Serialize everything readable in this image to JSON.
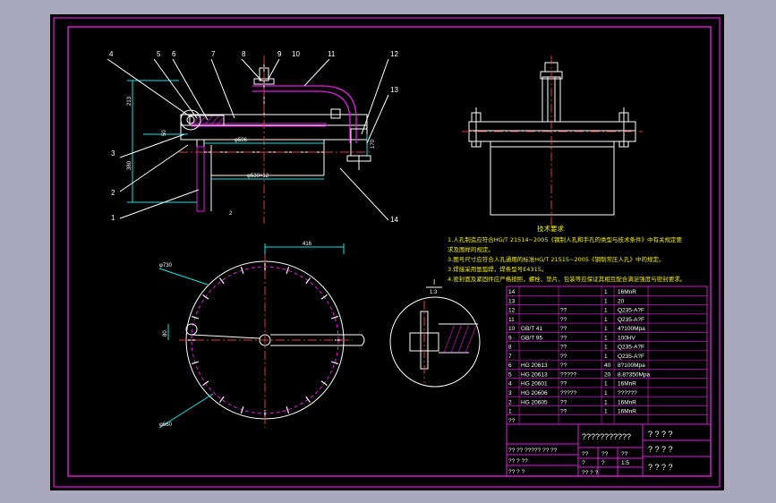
{
  "colors": {
    "background": "#a9a8bd",
    "sheet": "#000000",
    "frame": "#e01cdf",
    "outline": "#ffffff",
    "note_text": "#f4f000",
    "center_line": "#d24141",
    "dimension": "#18e2e2"
  },
  "callouts": [
    {
      "n": "4"
    },
    {
      "n": "5"
    },
    {
      "n": "6"
    },
    {
      "n": "7"
    },
    {
      "n": "8"
    },
    {
      "n": "9"
    },
    {
      "n": "10"
    },
    {
      "n": "11"
    },
    {
      "n": "12"
    },
    {
      "n": "13"
    },
    {
      "n": "3"
    },
    {
      "n": "2"
    },
    {
      "n": "1"
    },
    {
      "n": "14"
    }
  ],
  "dimensions": {
    "front_height": "213",
    "front_flange": "50",
    "front_body": "380",
    "inner_dia": "φ506",
    "outer_dia": "φ530×12",
    "small": "2",
    "right": "170",
    "plan_width": "416",
    "plan_bolt_circle": "φ730",
    "plan_side": "80",
    "plan_dia": "φ660",
    "detail_scale": "1:3",
    "detail_tag": "I"
  },
  "notes": {
    "heading": "技术要求",
    "lines": [
      "1.人孔制造应符合HG/T 21514~2005《钢制人孔和手孔的类型与技术条件》中有关规定要",
      "   求及图样的规定。",
      "3.图号尺寸应符合人孔通用的标准HG/T 21515~2005《钢制常压人孔》中的规定。",
      "3.焊接采用氩弧焊，焊条型号E4315。",
      "4.密封面及紧固件应严格按照，螺栓、垫片、包装等应保证其相互配合满足强度与密封要求。"
    ]
  },
  "bom_rows": [
    {
      "no": "14",
      "code": "",
      "name": "",
      "qty": "1",
      "mat": "16MnR"
    },
    {
      "no": "13",
      "code": "",
      "name": "",
      "qty": "1",
      "mat": "20"
    },
    {
      "no": "12",
      "code": "",
      "name": "??",
      "qty": "1",
      "mat": "Q235-A?F"
    },
    {
      "no": "11",
      "code": "",
      "name": "??",
      "qty": "1",
      "mat": "Q235-A?F"
    },
    {
      "no": "10",
      "code": "GB/T 41",
      "name": "??",
      "qty": "1",
      "mat": "4?100Mpa"
    },
    {
      "no": "9",
      "code": "GB/T 95",
      "name": "??",
      "qty": "1",
      "mat": "100HV"
    },
    {
      "no": "8",
      "code": "",
      "name": "??",
      "qty": "1",
      "mat": "Q235-A?F"
    },
    {
      "no": "7",
      "code": "",
      "name": "??",
      "qty": "1",
      "mat": "Q235-A?F"
    },
    {
      "no": "6",
      "code": "HG 20613",
      "name": "??",
      "qty": "40",
      "mat": "8?100Mpa"
    },
    {
      "no": "5",
      "code": "HG 20613",
      "name": "?????",
      "qty": "20",
      "mat": "8.8?350Mpa"
    },
    {
      "no": "4",
      "code": "HG 20601",
      "name": "??",
      "qty": "1",
      "mat": "16MnR"
    },
    {
      "no": "3",
      "code": "HG 20606",
      "name": "?????",
      "qty": "1",
      "mat": "??????"
    },
    {
      "no": "2",
      "code": "HG 20605",
      "name": "??",
      "qty": "1",
      "mat": "16MnR"
    },
    {
      "no": "1",
      "code": "",
      "name": "??",
      "qty": "1",
      "mat": "16MnR"
    },
    {
      "no": "??",
      "code": "",
      "name": "",
      "qty": "",
      "mat": ""
    }
  ],
  "title_block": {
    "drawing_title": "???????????",
    "scale_label": "1:5",
    "right_codes": [
      "? ? ? ?",
      "? ? ? ?",
      "? ? ? ?"
    ],
    "left_rows": [
      "??  ??  ?????  ??  ??",
      "??  ?  ??",
      "??  ?  ?"
    ],
    "mid_cells": [
      "??",
      "??",
      "??"
    ],
    "bottom_left": "??  ?  ?",
    "scale_cells": [
      "?",
      "?",
      "?"
    ]
  }
}
